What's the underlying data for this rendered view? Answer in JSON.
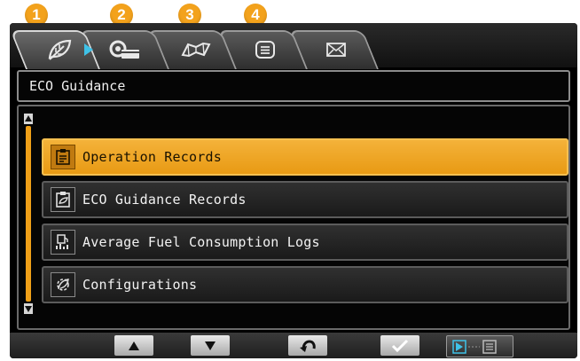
{
  "callouts": [
    "1",
    "2",
    "3",
    "4"
  ],
  "tabs": [
    {
      "icon": "leaf-icon",
      "active": true
    },
    {
      "icon": "key-card-icon",
      "active": false
    },
    {
      "icon": "map-icon",
      "active": false
    },
    {
      "icon": "document-icon",
      "active": false
    },
    {
      "icon": "envelope-icon",
      "active": false
    }
  ],
  "header": {
    "title": "ECO Guidance"
  },
  "menu": {
    "items": [
      {
        "label": "Operation Records",
        "icon": "clipboard-record-icon",
        "selected": true
      },
      {
        "label": "ECO Guidance Records",
        "icon": "clipboard-eco-icon",
        "selected": false
      },
      {
        "label": "Average Fuel Consumption Logs",
        "icon": "fuel-chart-icon",
        "selected": false
      },
      {
        "label": "Configurations",
        "icon": "settings-leaf-icon",
        "selected": false
      }
    ]
  },
  "bottom_buttons": [
    {
      "name": "up-button",
      "icon": "up-triangle-icon"
    },
    {
      "name": "down-button",
      "icon": "down-triangle-icon"
    },
    {
      "name": "back-button",
      "icon": "return-arrow-icon"
    },
    {
      "name": "confirm-button",
      "icon": "check-icon"
    },
    {
      "name": "next-page-button",
      "icon": "next-page-icon"
    }
  ],
  "colors": {
    "accent": "#f0a018",
    "callout": "#f3a21c",
    "marker": "#3fc2e8",
    "screen": "#000000"
  }
}
